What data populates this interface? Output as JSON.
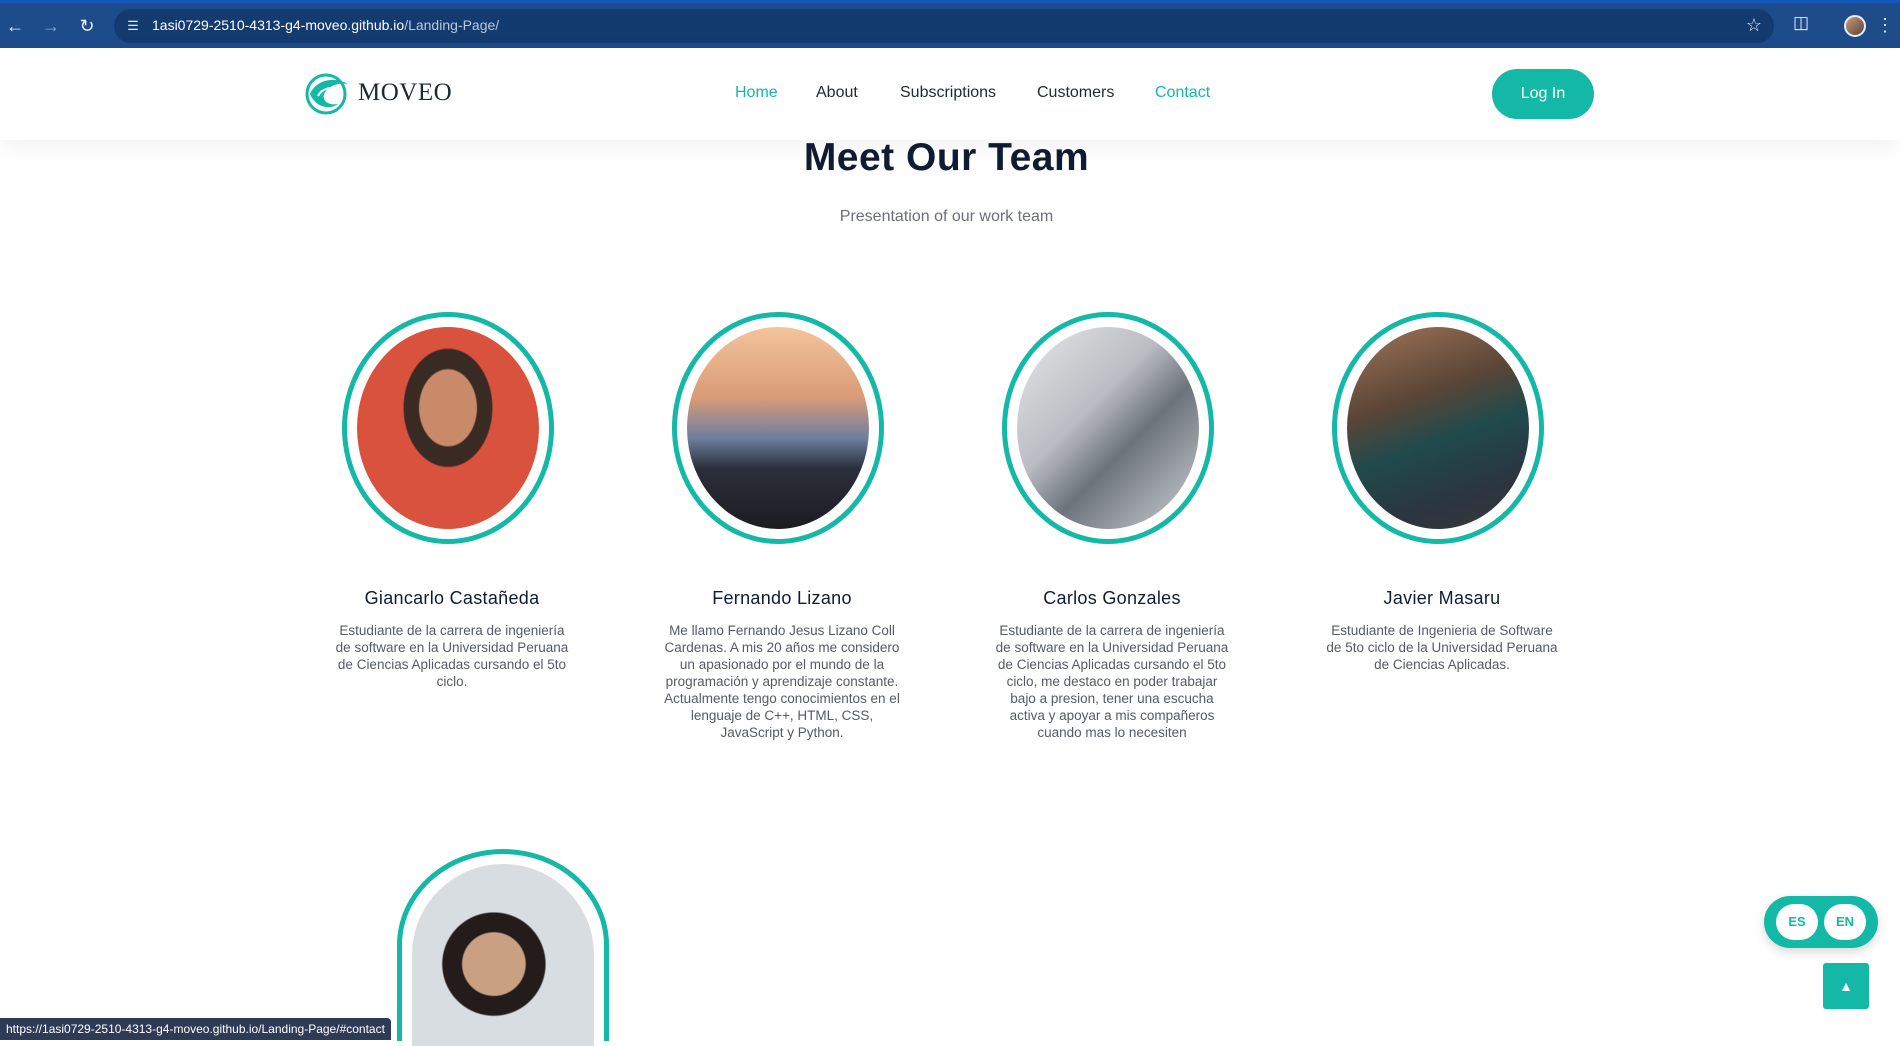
{
  "browser": {
    "url_host": "1asi0729-2510-4313-g4-moveo.github.io",
    "url_path": "/Landing-Page/"
  },
  "header": {
    "logo_text": "MOVEO",
    "nav": [
      {
        "label": "Home"
      },
      {
        "label": "About"
      },
      {
        "label": "Subscriptions"
      },
      {
        "label": "Customers"
      },
      {
        "label": "Contact"
      }
    ],
    "login_label": "Log In"
  },
  "team": {
    "title": "Meet Our Team",
    "subtitle": "Presentation of our work team",
    "members": [
      {
        "name": "Giancarlo Castañeda",
        "desc": "Estudiante de la carrera de ingeniería de software en la Universidad Peruana de Ciencias Aplicadas cursando el 5to ciclo."
      },
      {
        "name": "Fernando Lizano",
        "desc": "Me llamo Fernando Jesus Lizano Coll Cardenas. A mis 20 años me considero un apasionado por el mundo de la programación y aprendizaje constante. Actualmente tengo conocimientos en el lenguaje de C++, HTML, CSS, JavaScript y Python."
      },
      {
        "name": "Carlos Gonzales",
        "desc": "Estudiante de la carrera de ingeniería de software en la Universidad Peruana de Ciencias Aplicadas cursando el 5to ciclo, me destaco en poder trabajar bajo a presion, tener una escucha activa y apoyar a mis compañeros cuando mas lo necesiten"
      },
      {
        "name": "Javier Masaru",
        "desc": "Estudiante de Ingenieria de Software de 5to ciclo de la Universidad Peruana de Ciencias Aplicadas."
      }
    ]
  },
  "lang_switch": {
    "es": "ES",
    "en": "EN"
  },
  "status_bar_url": "https://1asi0729-2510-4313-g4-moveo.github.io/Landing-Page/#contact",
  "colors": {
    "accent": "#14b8a6",
    "heading": "#101c33",
    "browser_bar": "#1e4c8a"
  }
}
